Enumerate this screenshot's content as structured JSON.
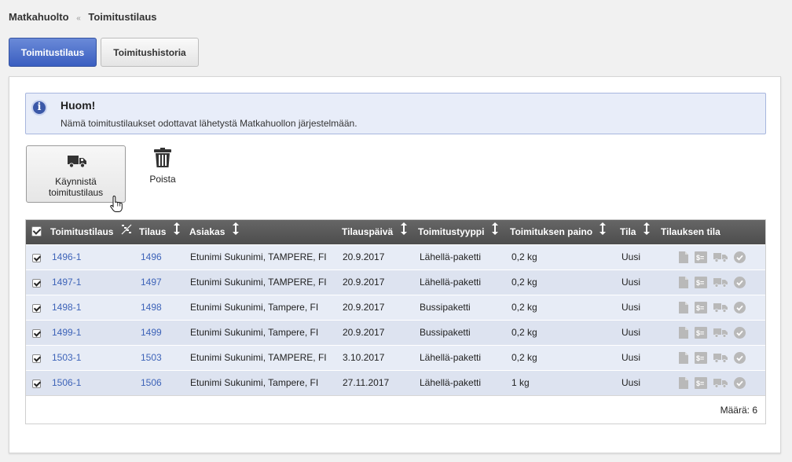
{
  "breadcrumb": {
    "root": "Matkahuolto",
    "separator": "«",
    "current": "Toimitustilaus"
  },
  "tabs": [
    {
      "label": "Toimitustilaus",
      "active": true
    },
    {
      "label": "Toimitushistoria",
      "active": false
    }
  ],
  "notice": {
    "title": "Huom!",
    "text": "Nämä toimitustilaukset odottavat lähetystä Matkahuollon järjestelmään."
  },
  "actions": {
    "start_label": "Käynnistä toimitustilaus",
    "delete_label": "Poista"
  },
  "grid": {
    "columns": {
      "order_delivery": "Toimitustilaus",
      "order": "Tilaus",
      "customer": "Asiakas",
      "order_date": "Tilauspäivä",
      "delivery_type": "Toimitustyyppi",
      "weight": "Toimituksen paino",
      "state": "Tila",
      "order_status": "Tilauksen tila"
    },
    "rows": [
      {
        "checked": true,
        "delivery_id": "1496-1",
        "order": "1496",
        "customer": "Etunimi Sukunimi, TAMPERE, FI",
        "date": "20.9.2017",
        "type": "Lähellä-paketti",
        "weight": "0,2 kg",
        "state": "Uusi"
      },
      {
        "checked": true,
        "delivery_id": "1497-1",
        "order": "1497",
        "customer": "Etunimi Sukunimi, TAMPERE, FI",
        "date": "20.9.2017",
        "type": "Lähellä-paketti",
        "weight": "0,2 kg",
        "state": "Uusi"
      },
      {
        "checked": true,
        "delivery_id": "1498-1",
        "order": "1498",
        "customer": "Etunimi Sukunimi, Tampere, FI",
        "date": "20.9.2017",
        "type": "Bussipaketti",
        "weight": "0,2 kg",
        "state": "Uusi"
      },
      {
        "checked": true,
        "delivery_id": "1499-1",
        "order": "1499",
        "customer": "Etunimi Sukunimi, Tampere, FI",
        "date": "20.9.2017",
        "type": "Bussipaketti",
        "weight": "0,2 kg",
        "state": "Uusi"
      },
      {
        "checked": true,
        "delivery_id": "1503-1",
        "order": "1503",
        "customer": "Etunimi Sukunimi, TAMPERE, FI",
        "date": "3.10.2017",
        "type": "Lähellä-paketti",
        "weight": "0,2 kg",
        "state": "Uusi"
      },
      {
        "checked": true,
        "delivery_id": "1506-1",
        "order": "1506",
        "customer": "Etunimi Sukunimi, Tampere, FI",
        "date": "27.11.2017",
        "type": "Lähellä-paketti",
        "weight": "1 kg",
        "state": "Uusi"
      }
    ],
    "status_icons": [
      "document-icon",
      "invoice-icon",
      "truck-icon",
      "check-circle-icon"
    ],
    "footer_count": "Määrä: 6"
  },
  "colors": {
    "accent": "#3a5ec0",
    "link": "#3d63b8",
    "header_bg": "#555555",
    "notice_bg": "#e8edf9"
  }
}
